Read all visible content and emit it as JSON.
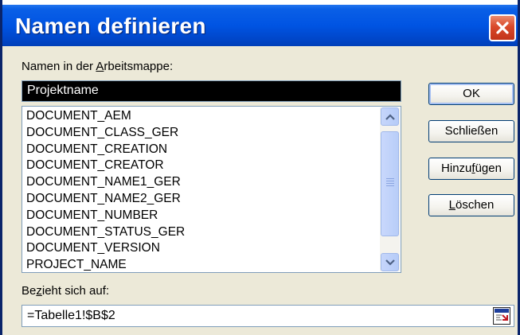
{
  "dialog": {
    "title": "Namen definieren",
    "close_icon": "close-icon"
  },
  "names_label": {
    "pre": "Namen in der ",
    "underlined": "A",
    "post": "rbeitsmappe:"
  },
  "name_input": {
    "value": "Projektname"
  },
  "names_list": {
    "items": [
      "DOCUMENT_AEM",
      "DOCUMENT_CLASS_GER",
      "DOCUMENT_CREATION",
      "DOCUMENT_CREATOR",
      "DOCUMENT_NAME1_GER",
      "DOCUMENT_NAME2_GER",
      "DOCUMENT_NUMBER",
      "DOCUMENT_STATUS_GER",
      "DOCUMENT_VERSION",
      "PROJECT_NAME"
    ]
  },
  "buttons": {
    "ok": "OK",
    "close": "Schließen",
    "add_pre": "Hinzu",
    "add_u": "f",
    "add_post": "ügen",
    "delete_u": "L",
    "delete_post": "öschen"
  },
  "refers_label": {
    "pre": "Be",
    "underlined": "z",
    "post": "ieht sich auf:"
  },
  "refers_input": {
    "value": "=Tabelle1!$B$2"
  },
  "colors": {
    "titlebar": "#0054e3",
    "close_button": "#d9492a",
    "dialog_bg": "#ece9d8"
  }
}
